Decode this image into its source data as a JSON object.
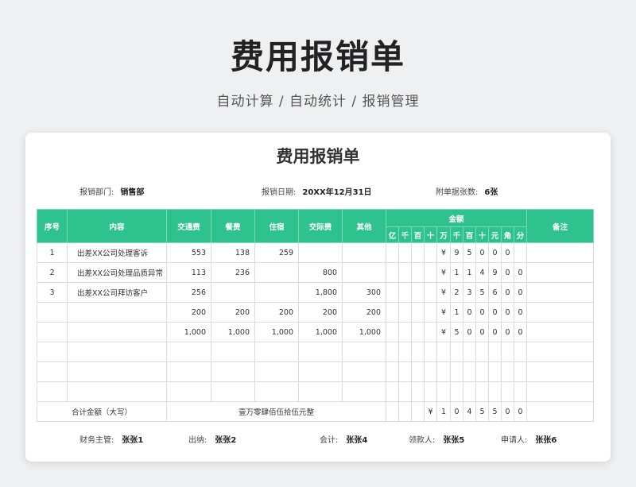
{
  "header": {
    "title": "费用报销单",
    "subtitle": "自动计算 / 自动统计 / 报销管理"
  },
  "form": {
    "title": "费用报销单",
    "department_label": "报销部门:",
    "department_value": "销售部",
    "date_label": "报销日期:",
    "date_value": "20XX年12月31日",
    "attachments_label": "附单据张数:",
    "attachments_value": "6张"
  },
  "table": {
    "headers": {
      "no": "序号",
      "content": "内容",
      "transport": "交通费",
      "meal": "餐费",
      "lodging": "住宿",
      "social": "交际费",
      "other": "其他",
      "amount": "金额",
      "remark": "备注"
    },
    "digit_headers": [
      "亿",
      "千",
      "百",
      "十",
      "万",
      "千",
      "百",
      "十",
      "元",
      "角",
      "分"
    ],
    "rows": [
      {
        "no": "1",
        "content": "出差XX公司处理客诉",
        "transport": "553",
        "meal": "138",
        "lodging": "259",
        "social": "",
        "other": "",
        "digits": [
          "",
          "",
          "",
          "",
          "¥",
          "9",
          "5",
          "0",
          "0",
          "0",
          ""
        ],
        "remark": ""
      },
      {
        "no": "2",
        "content": "出差XX公司处理品质异常",
        "transport": "113",
        "meal": "236",
        "lodging": "",
        "social": "800",
        "other": "",
        "digits": [
          "",
          "",
          "",
          "",
          "¥",
          "1",
          "1",
          "4",
          "9",
          "0",
          "0"
        ],
        "remark": ""
      },
      {
        "no": "3",
        "content": "出差XX公司拜访客户",
        "transport": "256",
        "meal": "",
        "lodging": "",
        "social": "1,800",
        "other": "300",
        "digits": [
          "",
          "",
          "",
          "",
          "¥",
          "2",
          "3",
          "5",
          "6",
          "0",
          "0"
        ],
        "remark": ""
      },
      {
        "no": "",
        "content": "",
        "transport": "200",
        "meal": "200",
        "lodging": "200",
        "social": "200",
        "other": "200",
        "digits": [
          "",
          "",
          "",
          "",
          "¥",
          "1",
          "0",
          "0",
          "0",
          "0",
          "0"
        ],
        "remark": ""
      },
      {
        "no": "",
        "content": "",
        "transport": "1,000",
        "meal": "1,000",
        "lodging": "1,000",
        "social": "1,000",
        "other": "1,000",
        "digits": [
          "",
          "",
          "",
          "",
          "¥",
          "5",
          "0",
          "0",
          "0",
          "0",
          "0"
        ],
        "remark": ""
      },
      {
        "no": "",
        "content": "",
        "transport": "",
        "meal": "",
        "lodging": "",
        "social": "",
        "other": "",
        "digits": [
          "",
          "",
          "",
          "",
          "",
          "",
          "",
          "",
          "",
          "",
          ""
        ],
        "remark": ""
      },
      {
        "no": "",
        "content": "",
        "transport": "",
        "meal": "",
        "lodging": "",
        "social": "",
        "other": "",
        "digits": [
          "",
          "",
          "",
          "",
          "",
          "",
          "",
          "",
          "",
          "",
          ""
        ],
        "remark": ""
      },
      {
        "no": "",
        "content": "",
        "transport": "",
        "meal": "",
        "lodging": "",
        "social": "",
        "other": "",
        "digits": [
          "",
          "",
          "",
          "",
          "",
          "",
          "",
          "",
          "",
          "",
          ""
        ],
        "remark": ""
      }
    ],
    "total": {
      "label": "合计金额（大写）",
      "words": "壹万零肆佰伍拾伍元整",
      "digits": [
        "",
        "",
        "",
        "¥",
        "1",
        "0",
        "4",
        "5",
        "5",
        "0",
        "0"
      ]
    }
  },
  "footer": {
    "finance_label": "财务主管:",
    "finance_value": "张张1",
    "cashier_label": "出纳:",
    "cashier_value": "张张2",
    "accountant_label": "会计:",
    "accountant_value": "张张4",
    "receiver_label": "领款人:",
    "receiver_value": "张张5",
    "applicant_label": "申请人:",
    "applicant_value": "张张6"
  },
  "colors": {
    "accent": "#2ec28e",
    "background": "#eef0f2"
  }
}
